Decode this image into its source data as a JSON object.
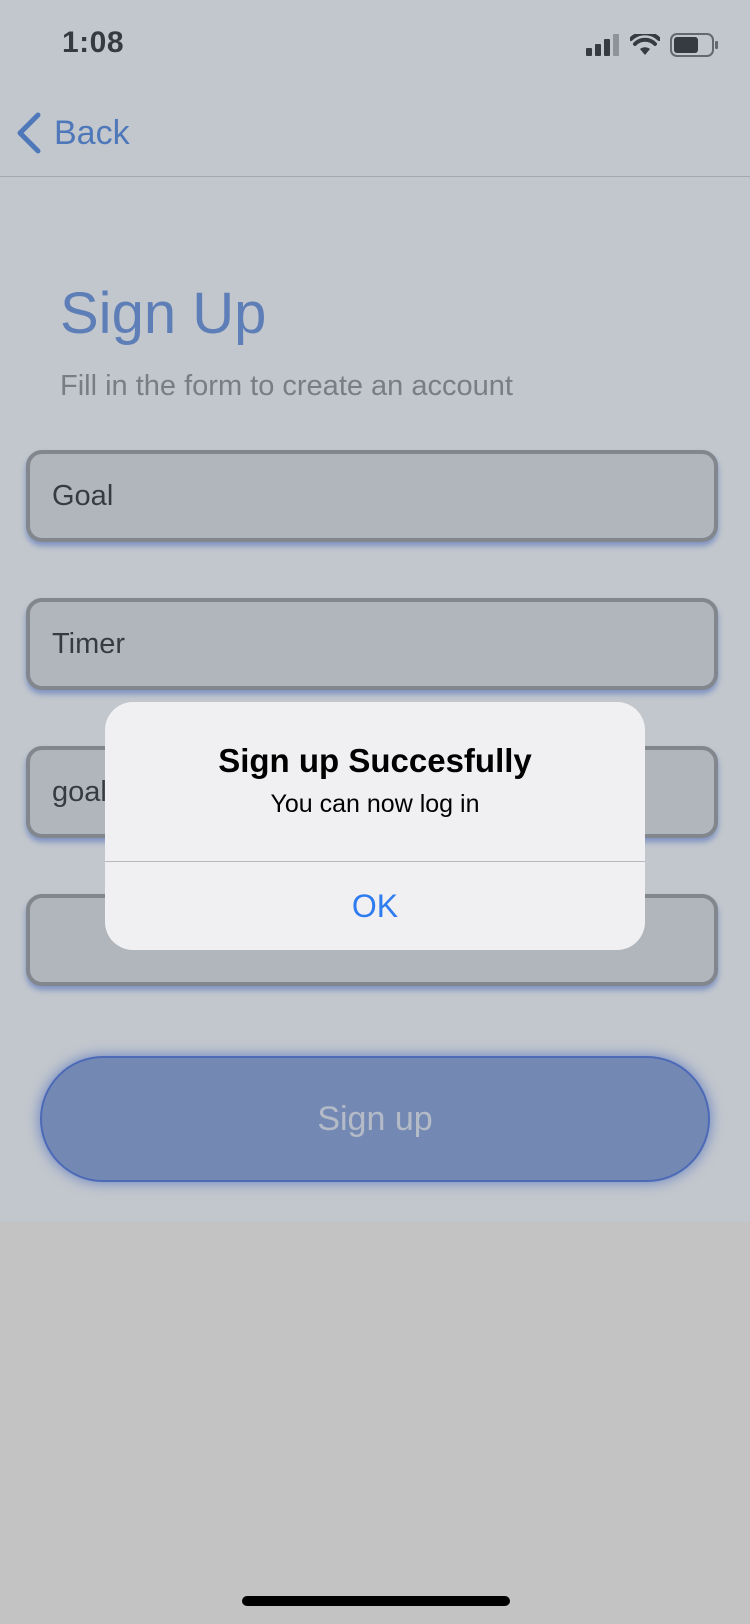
{
  "status_bar": {
    "time": "1:08"
  },
  "nav": {
    "back_label": "Back"
  },
  "form": {
    "title": "Sign Up",
    "subtitle": "Fill in the form to create an account",
    "fields": [
      {
        "value": "Goal"
      },
      {
        "value": "Timer"
      },
      {
        "value": "goal"
      },
      {
        "value": ""
      }
    ],
    "submit_label": "Sign up"
  },
  "alert": {
    "title": "Sign up Succesfully",
    "message": "You can now log in",
    "ok_label": "OK"
  },
  "colors": {
    "accent": "#2f6fdc",
    "alert_button": "#2f7bf0",
    "button_fill": "#6f8fd2"
  },
  "icons": [
    "chevron-left-icon",
    "cellular-signal-icon",
    "wifi-icon",
    "battery-icon"
  ]
}
